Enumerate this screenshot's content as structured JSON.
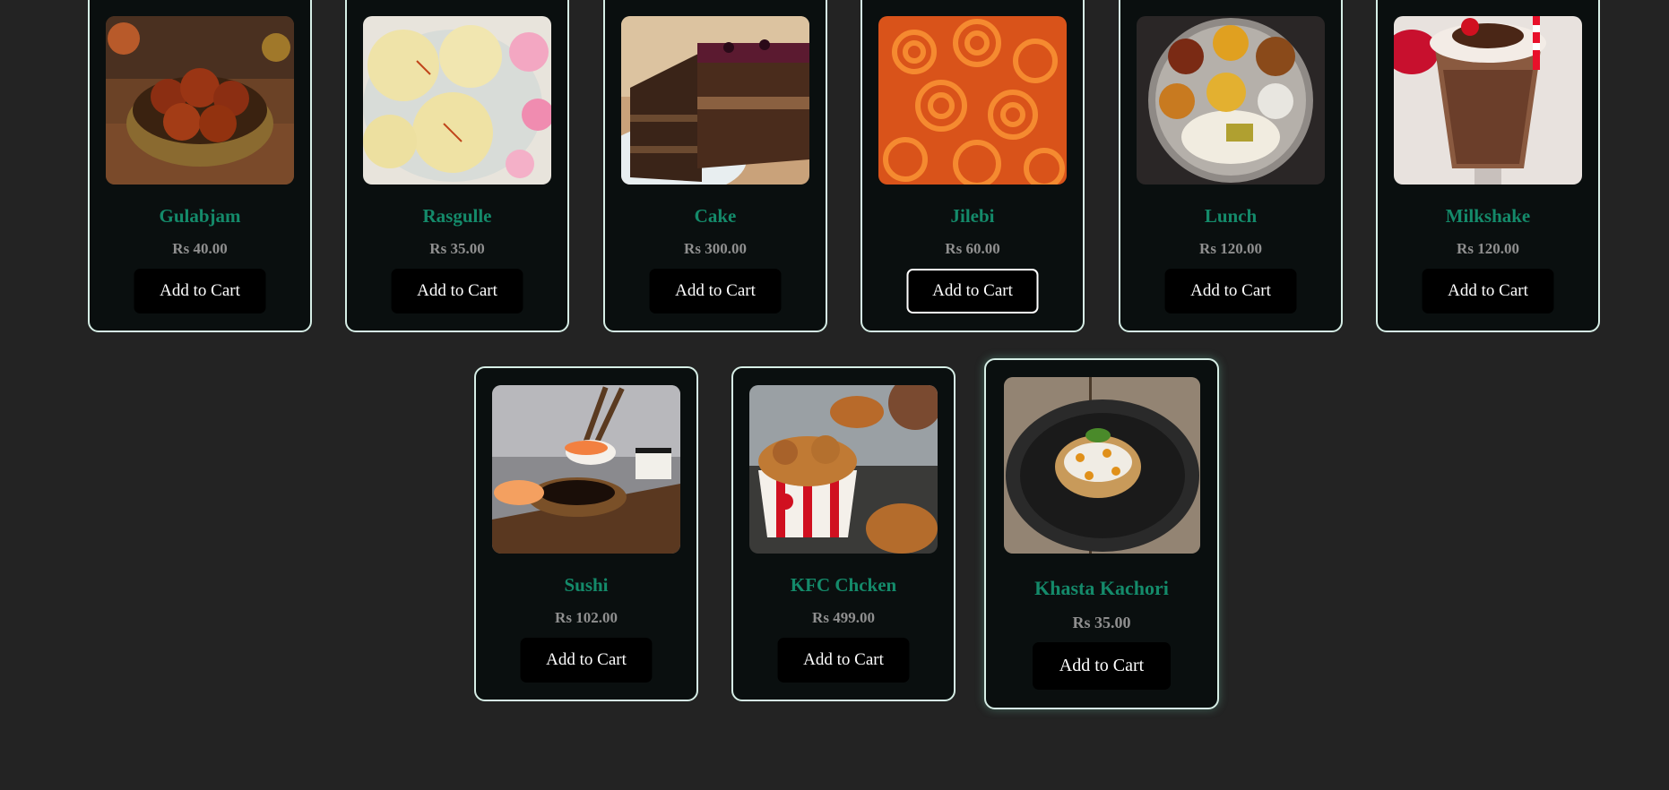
{
  "products": [
    {
      "name": "Gulabjam",
      "price": "Rs 40.00",
      "button_label": "Add to Cart",
      "image": "gulabjamun-photo"
    },
    {
      "name": "Rasgulle",
      "price": "Rs 35.00",
      "button_label": "Add to Cart",
      "image": "rasgulla-photo"
    },
    {
      "name": "Cake",
      "price": "Rs 300.00",
      "button_label": "Add to Cart",
      "image": "cake-photo"
    },
    {
      "name": "Jilebi",
      "price": "Rs 60.00",
      "button_label": "Add to Cart",
      "image": "jalebi-photo"
    },
    {
      "name": "Lunch",
      "price": "Rs 120.00",
      "button_label": "Add to Cart",
      "image": "thali-photo"
    },
    {
      "name": "Milkshake",
      "price": "Rs 120.00",
      "button_label": "Add to Cart",
      "image": "milkshake-photo"
    },
    {
      "name": "Sushi",
      "price": "Rs 102.00",
      "button_label": "Add to Cart",
      "image": "sushi-photo"
    },
    {
      "name": "KFC Chcken",
      "price": "Rs 499.00",
      "button_label": "Add to Cart",
      "image": "fried-chicken-photo"
    },
    {
      "name": "Khasta Kachori",
      "price": "Rs 35.00",
      "button_label": "Add to Cart",
      "image": "kachori-photo"
    }
  ],
  "colors": {
    "page_background": "#232323",
    "card_background": "#0a0f0f",
    "card_border": "#d6eee6",
    "product_name": "#148a6a",
    "price": "#8f8f8f",
    "button_background": "#000000",
    "button_text": "#ffffff"
  }
}
